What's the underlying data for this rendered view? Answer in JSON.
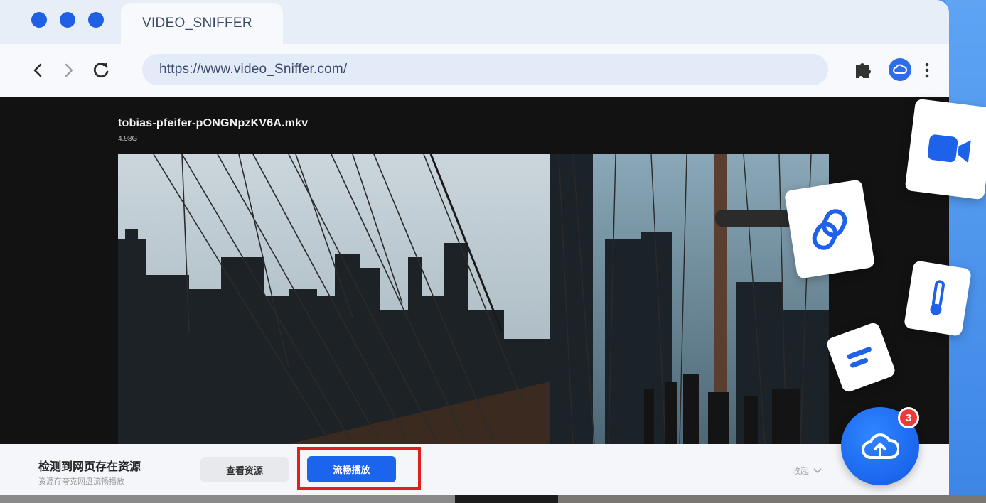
{
  "tab": {
    "title": "VIDEO_SNIFFER"
  },
  "toolbar": {
    "url": "https://www.video_Sniffer.com/"
  },
  "video": {
    "file_name": "tobias-pfeifer-pONGNpzKV6A.mkv",
    "file_size": "4.98G"
  },
  "bottom_bar": {
    "title": "检测到网页存在资源",
    "subtitle": "资源存夸克网盘流畅播放",
    "view_button": "查看资源",
    "play_button": "流畅播放",
    "collapse_label": "收起"
  },
  "upload": {
    "badge_count": "3"
  },
  "colors": {
    "accent": "#1b64ee",
    "highlight": "#e0201c",
    "badge": "#f03a3a"
  }
}
